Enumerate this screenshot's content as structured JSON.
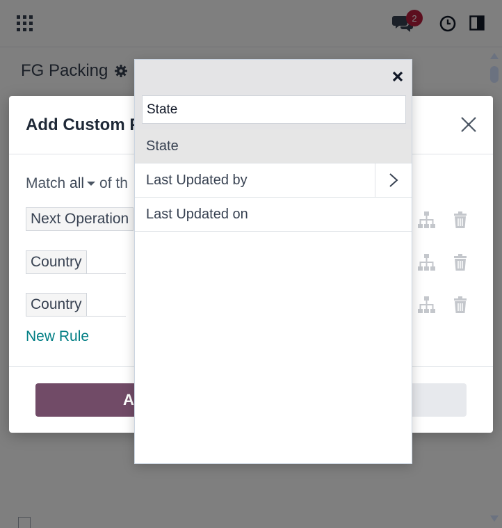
{
  "navbar": {
    "apps_icon": "apps-grid-icon",
    "chat_icon": "chat-icon",
    "chat_badge": "2",
    "clock_icon": "clock-icon",
    "panel_icon": "panel-icon"
  },
  "page": {
    "title": "FG Packing",
    "settings_icon": "gear-icon"
  },
  "modal": {
    "title": "Add Custom Fi",
    "close_icon": "close-icon",
    "match_prefix": "Match",
    "match_value": "all",
    "match_suffix": "of th",
    "rules": [
      {
        "field": "Next Operation"
      },
      {
        "field": "Country"
      },
      {
        "field": "Country"
      }
    ],
    "rule_action_icons": [
      "hierarchy-icon",
      "trash-icon"
    ],
    "new_rule_label": "New Rule",
    "primary_button_label": "A"
  },
  "popover": {
    "search_value": "State",
    "close_icon": "close-icon",
    "items": [
      {
        "label": "State",
        "selected": true
      },
      {
        "label": "Last Updated by",
        "has_submenu": true
      },
      {
        "label": "Last Updated on"
      }
    ],
    "submenu_icon": "chevron-right-icon"
  },
  "colors": {
    "brand": "#714b67",
    "link": "#017e84",
    "badge": "#b91c3c"
  }
}
